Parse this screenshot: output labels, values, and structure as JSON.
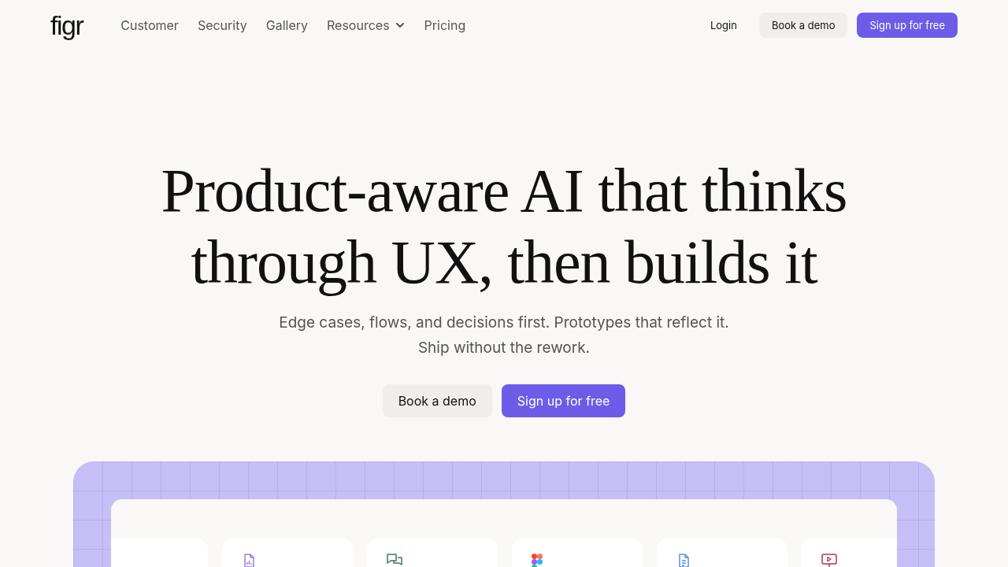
{
  "header": {
    "logo": "figr",
    "nav": [
      {
        "label": "Customer",
        "kind": "link"
      },
      {
        "label": "Security",
        "kind": "link"
      },
      {
        "label": "Gallery",
        "kind": "link"
      },
      {
        "label": "Resources",
        "kind": "dropdown"
      },
      {
        "label": "Pricing",
        "kind": "link"
      }
    ],
    "actions": [
      {
        "label": "Login",
        "kind": "plain"
      },
      {
        "label": "Book a demo",
        "kind": "secondary"
      },
      {
        "label": "Sign up for free",
        "kind": "primary"
      }
    ]
  },
  "hero": {
    "headline_lines": [
      "Product-aware AI that thinks",
      "through UX, then builds it"
    ],
    "subtitle_lines": [
      "Edge cases, flows, and decisions first. Prototypes that reflect it.",
      "Ship without the rework."
    ],
    "buttons": [
      {
        "label": "Book a demo",
        "kind": "secondary"
      },
      {
        "label": "Sign up for free",
        "kind": "primary"
      }
    ]
  },
  "showcase": {
    "cards": [
      {
        "kind": "blank"
      },
      {
        "kind": "chart-doc"
      },
      {
        "kind": "chat"
      },
      {
        "kind": "figma"
      },
      {
        "kind": "document"
      },
      {
        "kind": "presentation"
      }
    ]
  }
}
